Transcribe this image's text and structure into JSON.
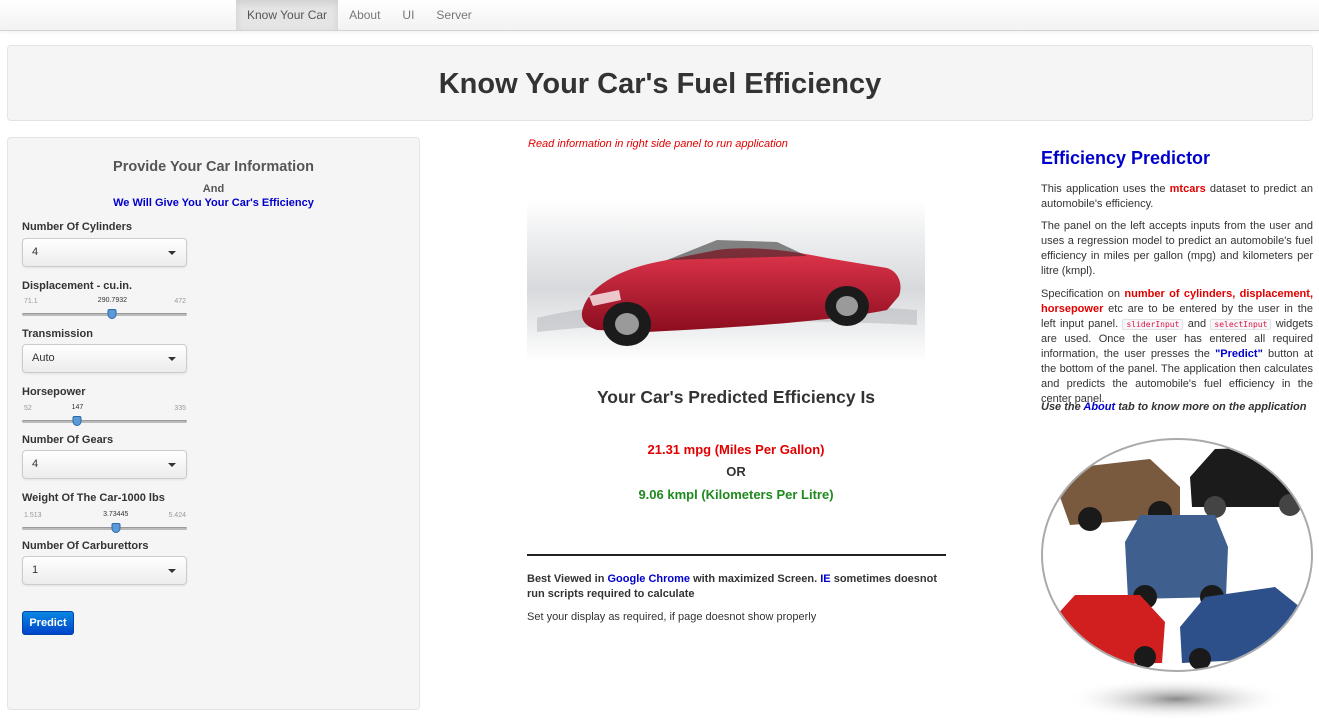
{
  "nav": {
    "tabs": [
      "Know Your Car",
      "About",
      "UI",
      "Server"
    ],
    "active": "Know Your Car"
  },
  "header": {
    "title": "Know Your Car's Fuel Efficiency"
  },
  "sidebar": {
    "heading": "Provide Your Car Information",
    "and": "And",
    "subheading": "We Will Give You Your Car's Efficiency",
    "cylinders": {
      "label": "Number Of Cylinders",
      "value": "4"
    },
    "displacement": {
      "label": "Displacement - cu.in.",
      "min": "71.1",
      "max": "472",
      "value": "290.7932",
      "fraction": 0.548
    },
    "transmission": {
      "label": "Transmission",
      "value": "Auto"
    },
    "horsepower": {
      "label": "Horsepower",
      "min": "52",
      "max": "335",
      "value": "147",
      "fraction": 0.336
    },
    "gears": {
      "label": "Number Of Gears",
      "value": "4"
    },
    "weight": {
      "label": "Weight Of The Car-1000 lbs",
      "min": "1.513",
      "max": "5.424",
      "value": "3.73445",
      "fraction": 0.568
    },
    "carburettors": {
      "label": "Number Of Carburettors",
      "value": "1"
    },
    "predict_label": "Predict"
  },
  "center": {
    "notice": "Read information in right side panel to run application",
    "prediction_heading": "Your Car's Predicted Efficiency Is",
    "mpg": "21.31 mpg (Miles Per Gallon)",
    "or": "OR",
    "kmpl": "9.06 kmpl (Kilometers Per Litre)",
    "best_viewed_1": "Best Viewed in ",
    "best_viewed_chrome": "Google Chrome",
    "best_viewed_2": " with maximized Screen. ",
    "best_viewed_ie": "IE",
    "best_viewed_3": " sometimes doesnot run scripts required to calculate",
    "set_display": "Set your display as required, if page doesnot show properly"
  },
  "right": {
    "title": "Efficiency Predictor",
    "p1_a": "This application uses the ",
    "p1_mtcars": "mtcars",
    "p1_b": " dataset to predict an automobile's efficiency.",
    "p2": "The panel on the left accepts inputs from the user and uses a regression model to predict an automobile's fuel efficiency in miles per gallon (mpg) and kilometers per litre (kmpl).",
    "p3_a": "Specification on ",
    "p3_red": "number of cylinders, displacement, horsepower",
    "p3_b": " etc are to be entered by the user in the left input panel. ",
    "p3_code1": "sliderInput",
    "p3_and": " and ",
    "p3_code2": "selectInput",
    "p3_c": " widgets are used. Once the user has entered all required information, the user presses the ",
    "p3_predict": "\"Predict\"",
    "p3_d": " button at the bottom of the panel. The application then calculates and predicts the automobile's fuel efficiency in the center panel.",
    "use_a": "Use the ",
    "use_about": "About",
    "use_b": " tab to know more on the application"
  }
}
